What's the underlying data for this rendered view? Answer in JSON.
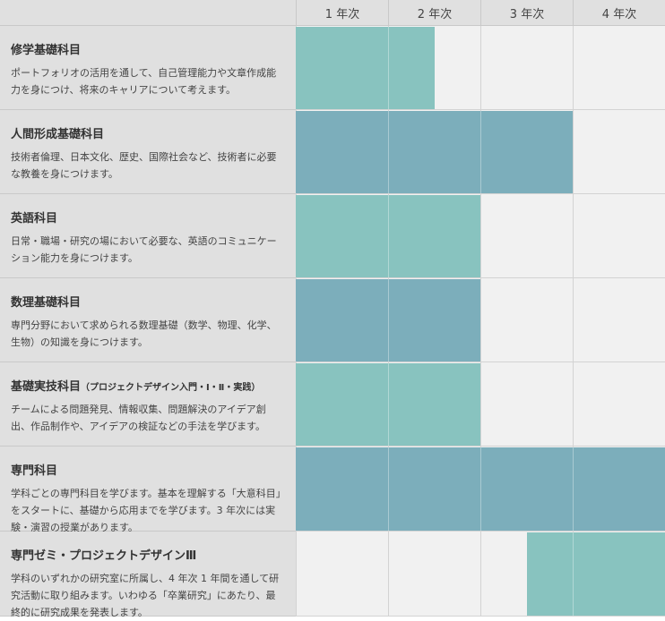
{
  "header": {
    "years": [
      "1 年次",
      "2 年次",
      "3 年次",
      "4 年次"
    ]
  },
  "courses": [
    {
      "title": "修学基礎科目",
      "subtitle": "",
      "desc": "ポートフォリオの活用を通して、自己管理能力や文章作成能力を身につけ、将来のキャリアについて考えます。",
      "span_years": [
        0,
        1.5
      ],
      "color": "#88c3bf"
    },
    {
      "title": "人間形成基礎科目",
      "subtitle": "",
      "desc": "技術者倫理、日本文化、歴史、国際社会など、技術者に必要な教養を身につけます。",
      "span_years": [
        0,
        3
      ],
      "color": "#7caebb"
    },
    {
      "title": "英語科目",
      "subtitle": "",
      "desc": "日常・職場・研究の場において必要な、英語のコミュニケーション能力を身につけます。",
      "span_years": [
        0,
        2
      ],
      "color": "#88c3bf"
    },
    {
      "title": "数理基礎科目",
      "subtitle": "",
      "desc": "専門分野において求められる数理基礎（数学、物理、化学、生物）の知識を身につけます。",
      "span_years": [
        0,
        2
      ],
      "color": "#7caebb"
    },
    {
      "title": "基礎実技科目",
      "subtitle": "（プロジェクトデザイン入門・Ⅰ・Ⅱ・実践）",
      "desc": "チームによる問題発見、情報収集、問題解決のアイデア創出、作品制作や、アイデアの検証などの手法を学びます。",
      "span_years": [
        0,
        2
      ],
      "color": "#88c3bf"
    },
    {
      "title": "専門科目",
      "subtitle": "",
      "desc": "学科ごとの専門科目を学びます。基本を理解する「大意科目」をスタートに、基礎から応用までを学びます。3 年次には実験・演習の授業があります。",
      "span_years": [
        0,
        4
      ],
      "color": "#7caebb"
    },
    {
      "title": "専門ゼミ・プロジェクトデザインⅢ",
      "subtitle": "",
      "desc": "学科のいずれかの研究室に所属し、4 年次 1 年間を通して研究活動に取り組みます。いわゆる「卒業研究」にあたり、最終的に研究成果を発表します。",
      "span_years": [
        2.5,
        4
      ],
      "color": "#88c3bf"
    }
  ]
}
